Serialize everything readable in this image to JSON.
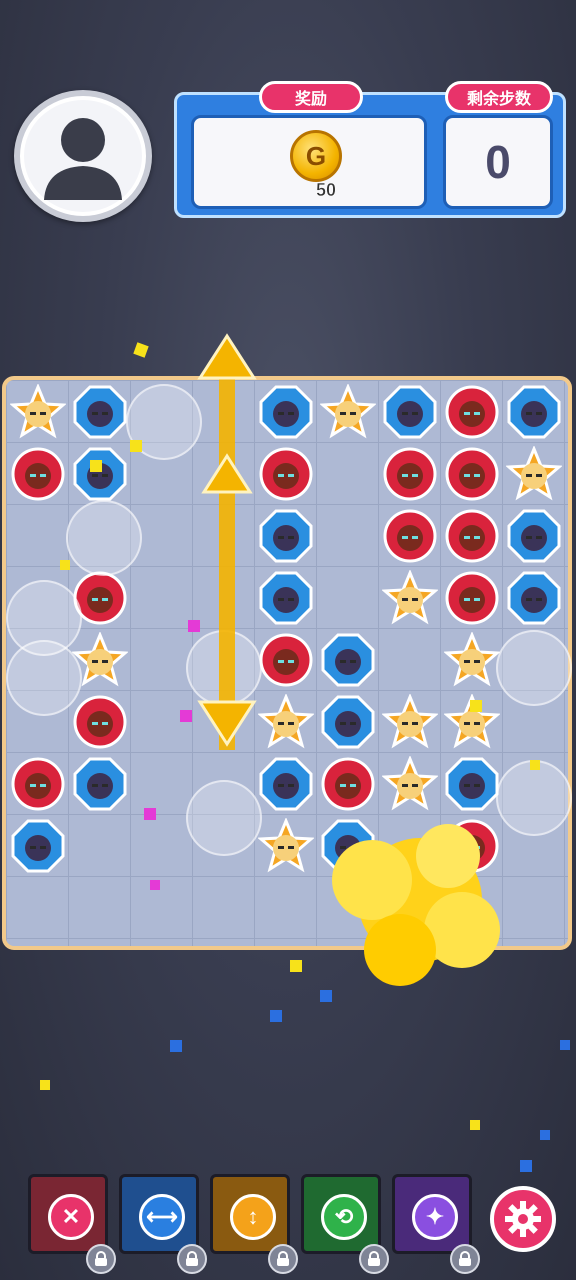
{
  "header": {
    "reward_label": "奖励",
    "steps_label": "剩余步数",
    "coin_symbol": "G",
    "coin_amount": "50",
    "steps_remaining": "0"
  },
  "board": {
    "rows": 8,
    "cols": 9,
    "grid": [
      [
        "star",
        "ninja",
        "",
        "",
        "ninja",
        "star",
        "ninja",
        "red",
        "ninja"
      ],
      [
        "red",
        "ninja",
        "",
        "",
        "red",
        "",
        "red",
        "red",
        "star"
      ],
      [
        "",
        "",
        "",
        "",
        "ninja",
        "",
        "red",
        "red",
        "ninja"
      ],
      [
        "",
        "red",
        "",
        "",
        "ninja",
        "",
        "star",
        "red",
        "ninja"
      ],
      [
        "",
        "star",
        "",
        "",
        "red",
        "ninja",
        "",
        "star",
        ""
      ],
      [
        "",
        "red",
        "",
        "",
        "star",
        "ninja",
        "star",
        "star",
        ""
      ],
      [
        "red",
        "ninja",
        "",
        "",
        "ninja",
        "red",
        "star",
        "ninja",
        ""
      ],
      [
        "ninja",
        "",
        "",
        "",
        "star",
        "ninja",
        "",
        "red",
        ""
      ]
    ],
    "extra": [
      {
        "row": 8,
        "col": 4,
        "kind": "ninja"
      },
      {
        "row": 8,
        "col": 8,
        "kind": "red"
      }
    ]
  },
  "tile_types": {
    "star": {
      "color": "#f5a623",
      "icon": "star-tile-icon"
    },
    "ninja": {
      "color": "#2a8fe0",
      "icon": "ninja-tile-icon"
    },
    "red": {
      "color": "#d9233c",
      "icon": "red-tile-icon"
    }
  },
  "boosters": [
    {
      "name": "booster-hammer",
      "icon": "x-icon",
      "bg": "#7a2633",
      "circle": "#e8336a",
      "glyph": "✕",
      "locked": true
    },
    {
      "name": "booster-swap-row",
      "icon": "horizontal-arrows-icon",
      "bg": "#1f4f8f",
      "circle": "#2a7fe0",
      "glyph": "⟷",
      "locked": true
    },
    {
      "name": "booster-swap-col",
      "icon": "vertical-arrows-icon",
      "bg": "#8a5a10",
      "circle": "#f4a21a",
      "glyph": "↕",
      "locked": true
    },
    {
      "name": "booster-shuffle",
      "icon": "shuffle-icon",
      "bg": "#1f6a30",
      "circle": "#2fb24a",
      "glyph": "⟲",
      "locked": true
    },
    {
      "name": "booster-magic",
      "icon": "magic-icon",
      "bg": "#4a2a7a",
      "circle": "#8a4fe0",
      "glyph": "✦",
      "locked": true
    }
  ]
}
